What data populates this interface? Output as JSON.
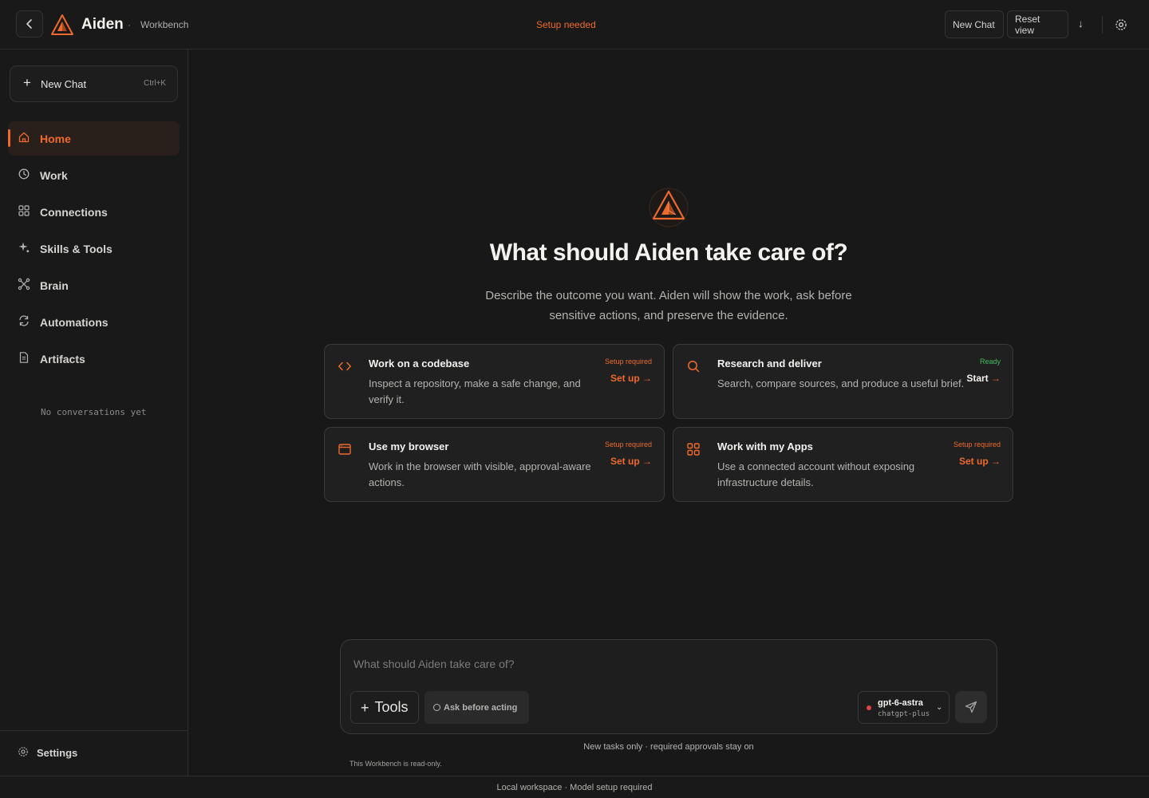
{
  "header": {
    "back_icon": "chevron-left-icon",
    "logo_icon": "aiden-triangle-logo",
    "app_name": "Aiden",
    "separator": "·",
    "section": "Workbench",
    "status": "Setup needed",
    "new_chat_label": "New Chat",
    "reset_view_label": "Reset view",
    "download_icon": "arrow-down-icon",
    "download_glyph": "↓",
    "settings_icon": "gear-icon"
  },
  "sidebar": {
    "new_chat": {
      "icon": "plus-icon",
      "glyph": "+",
      "label": "New Chat",
      "shortcut": "Ctrl+K"
    },
    "items": [
      {
        "label": "Home",
        "icon": "home-icon",
        "active": true
      },
      {
        "label": "Work",
        "icon": "clock-icon",
        "active": false
      },
      {
        "label": "Connections",
        "icon": "grid-icon",
        "active": false
      },
      {
        "label": "Skills & Tools",
        "icon": "sparkles-icon",
        "active": false
      },
      {
        "label": "Brain",
        "icon": "network-icon",
        "active": false
      },
      {
        "label": "Automations",
        "icon": "refresh-icon",
        "active": false
      },
      {
        "label": "Artifacts",
        "icon": "document-icon",
        "active": false
      }
    ],
    "empty_state": "No conversations yet",
    "settings_label": "Settings",
    "settings_icon": "gear-icon"
  },
  "main": {
    "hero_icon": "aiden-triangle-logo",
    "title": "What should Aiden take care of?",
    "subtitle_line1": "Describe the outcome you want. Aiden will show the work, ask before",
    "subtitle_line2": "sensitive actions, and preserve the evidence.",
    "cards": [
      {
        "title": "Work on a codebase",
        "description": "Inspect a repository, make a safe change, and verify it.",
        "status": "Setup required",
        "action": "Set up",
        "arrow": "→",
        "icon": "code-icon"
      },
      {
        "title": "Research and deliver",
        "description": "Search, compare sources, and produce a useful brief.",
        "status": "Ready",
        "action": "Start",
        "arrow": "→",
        "icon": "search-icon"
      },
      {
        "title": "Use my browser",
        "description": "Work in the browser with visible, approval-aware actions.",
        "status": "Setup required",
        "action": "Set up",
        "arrow": "→",
        "icon": "browser-window-icon"
      },
      {
        "title": "Work with my Apps",
        "description": "Use a connected account without exposing infrastructure details.",
        "status": "Setup required",
        "action": "Set up",
        "arrow": "→",
        "icon": "apps-grid-icon"
      }
    ]
  },
  "composer": {
    "placeholder": "What should Aiden take care of?",
    "value": "",
    "tools_glyph": "+",
    "tools_label": "Tools",
    "ask_label": "Ask before acting",
    "model_name": "gpt-6-astra",
    "model_plan": "chatgpt-plus",
    "model_chevron": "⌄",
    "send_icon": "send-icon",
    "note": "New tasks only · required approvals stay on",
    "readonly_note": "This Workbench is read-only."
  },
  "footer": {
    "text": "Local workspace · Model setup required"
  },
  "colors": {
    "accent": "#ee6a2c",
    "ready": "#3fbf62",
    "model_dot": "#e04545",
    "background": "#181818"
  }
}
